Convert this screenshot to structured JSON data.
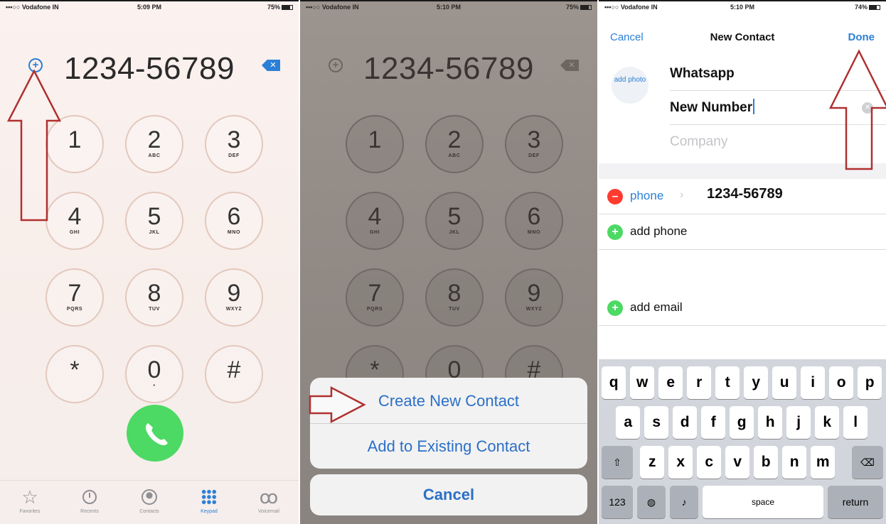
{
  "status_bars": [
    {
      "carrier": "•••○○ Vodafone IN",
      "time": "5:09 PM",
      "battery": "75%",
      "level": 0.75
    },
    {
      "carrier": "•••○○ Vodafone IN",
      "time": "5:10 PM",
      "battery": "75%",
      "level": 0.75
    },
    {
      "carrier": "•••○○ Vodafone IN",
      "time": "5:10 PM",
      "battery": "74%",
      "level": 0.74
    }
  ],
  "dialer": {
    "number": "1234-56789",
    "keys": [
      {
        "digit": "1",
        "letters": ""
      },
      {
        "digit": "2",
        "letters": "ABC"
      },
      {
        "digit": "3",
        "letters": "DEF"
      },
      {
        "digit": "4",
        "letters": "GHI"
      },
      {
        "digit": "5",
        "letters": "JKL"
      },
      {
        "digit": "6",
        "letters": "MNO"
      },
      {
        "digit": "7",
        "letters": "PQRS"
      },
      {
        "digit": "8",
        "letters": "TUV"
      },
      {
        "digit": "9",
        "letters": "WXYZ"
      },
      {
        "digit": "*",
        "letters": ""
      },
      {
        "digit": "0",
        "letters": "•"
      },
      {
        "digit": "#",
        "letters": ""
      }
    ],
    "tabs": [
      {
        "label": "Favorites",
        "icon": "star-icon"
      },
      {
        "label": "Recents",
        "icon": "clock-icon"
      },
      {
        "label": "Contacts",
        "icon": "contact-icon"
      },
      {
        "label": "Keypad",
        "icon": "keypad-grid-icon",
        "active": true
      },
      {
        "label": "Voicemail",
        "icon": "voicemail-icon"
      }
    ]
  },
  "action_sheet": {
    "create": "Create New Contact",
    "add_existing": "Add to Existing Contact",
    "cancel": "Cancel"
  },
  "contact_form": {
    "cancel": "Cancel",
    "title": "New Contact",
    "done": "Done",
    "add_photo": "add photo",
    "first_name": "Whatsapp",
    "last_name": "New Number",
    "company_placeholder": "Company",
    "phone_label": "phone",
    "phone_value": "1234-56789",
    "add_phone": "add phone",
    "add_email": "add email"
  },
  "keyboard": {
    "row1": [
      "q",
      "w",
      "e",
      "r",
      "t",
      "y",
      "u",
      "i",
      "o",
      "p"
    ],
    "row2": [
      "a",
      "s",
      "d",
      "f",
      "g",
      "h",
      "j",
      "k",
      "l"
    ],
    "row3": [
      "z",
      "x",
      "c",
      "v",
      "b",
      "n",
      "m"
    ],
    "num_key": "123",
    "space": "space",
    "return": "return"
  },
  "colors": {
    "ios_blue": "#2b80d6",
    "call_green": "#4cd964",
    "delete_red": "#ff3b30",
    "annotation_arrow": "#b03030"
  }
}
